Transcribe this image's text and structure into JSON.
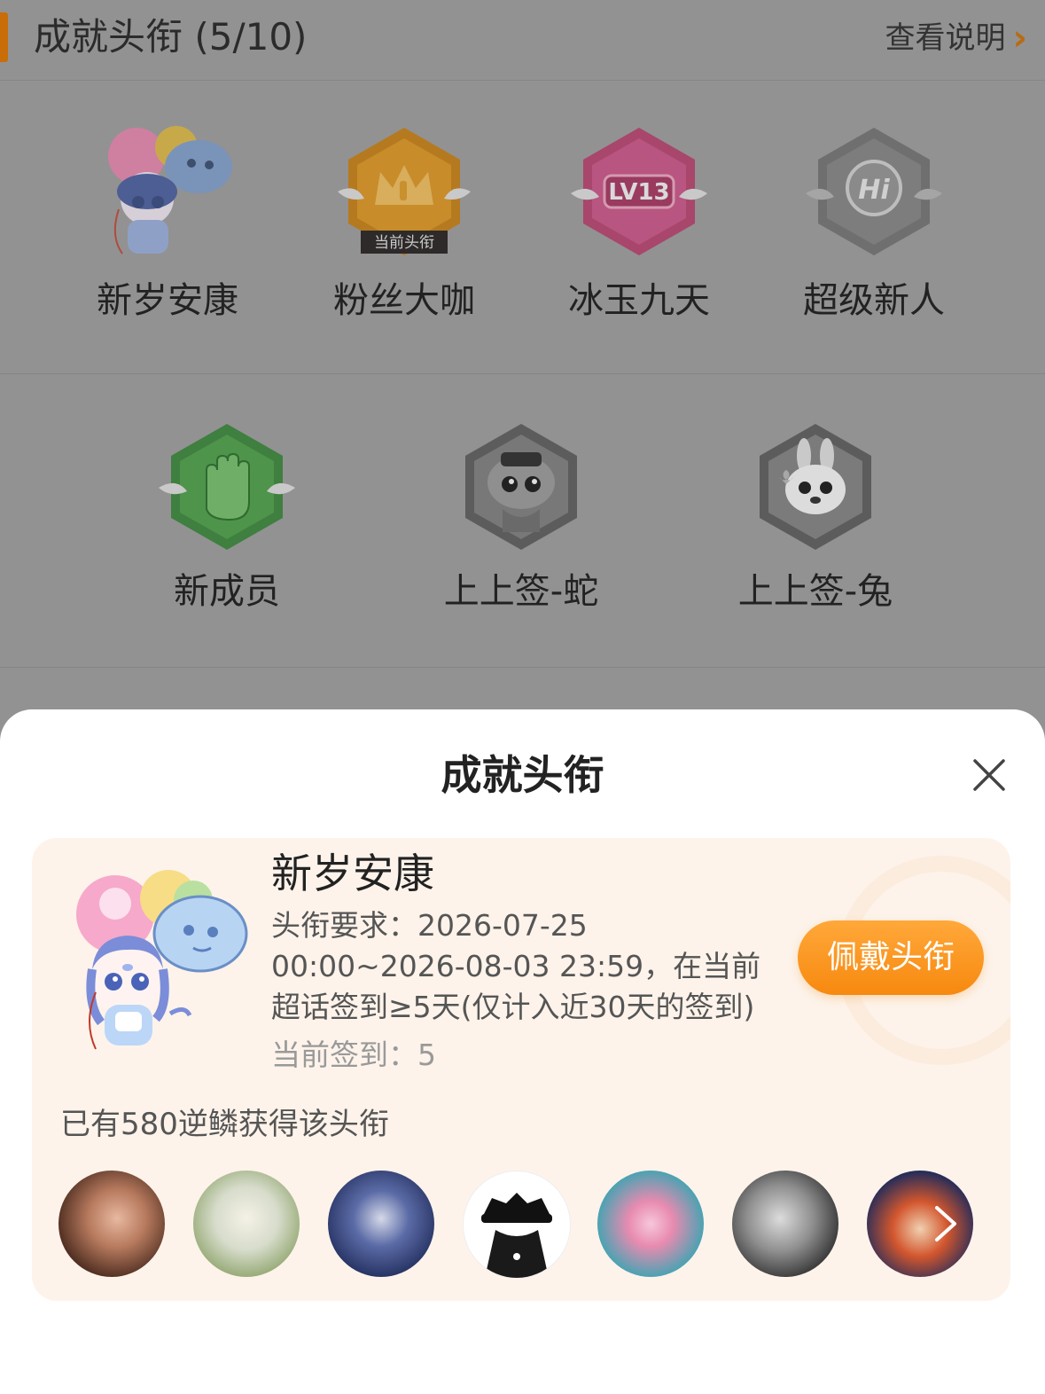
{
  "header": {
    "title": "成就头衔 (5/10)",
    "link_label": "查看说明",
    "accent_color": "#c86d08"
  },
  "badges": [
    {
      "label": "新岁安康",
      "icon": "mascot-balloons-icon"
    },
    {
      "label": "粉丝大咖",
      "icon": "crown-hexagon-icon",
      "tag": "当前头衔"
    },
    {
      "label": "冰玉九天",
      "icon": "lv13-hexagon-icon",
      "text": "LV13"
    },
    {
      "label": "超级新人",
      "icon": "hi-hexagon-icon",
      "text": "Hi"
    },
    {
      "label": "新成员",
      "icon": "hand-hexagon-icon"
    },
    {
      "label": "上上签-蛇",
      "icon": "snake-hexagon-icon"
    },
    {
      "label": "上上签-兔",
      "icon": "rabbit-hexagon-icon"
    }
  ],
  "sheet": {
    "title": "成就头衔",
    "close_icon": "close-icon",
    "card": {
      "name": "新岁安康",
      "requirement": "头衔要求：2026-07-25 00:00~2026-08-03 23:59，在当前超话签到≥5天(仅计入近30天的签到)",
      "current": "当前签到：5",
      "wear_label": "佩戴头衔",
      "owners_text": "已有580逆鳞获得该头衔"
    }
  }
}
